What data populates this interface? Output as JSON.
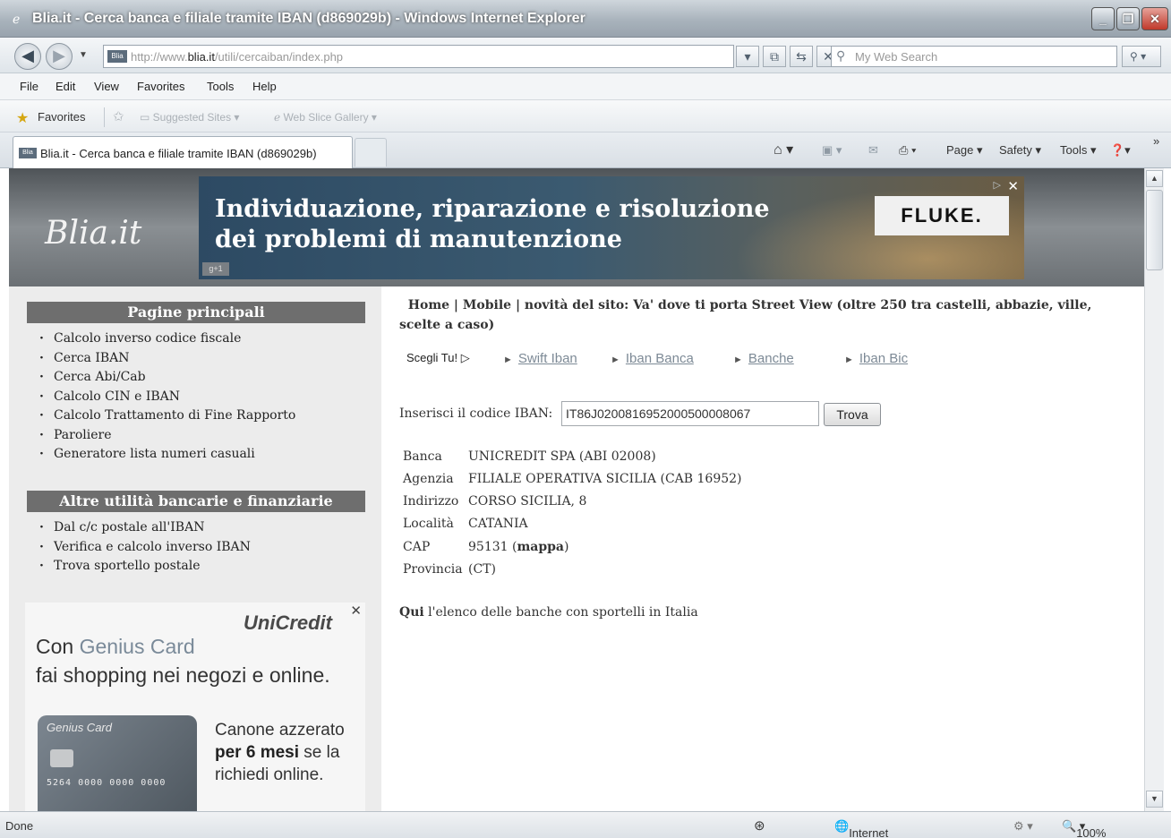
{
  "window": {
    "title": "Blia.it - Cerca banca e filiale tramite IBAN (d869029b) - Windows Internet Explorer",
    "buttons": {
      "minimize": "_",
      "maximize": "❐",
      "close": "✕"
    }
  },
  "address": {
    "url_prefix": "http://www.",
    "url_domain": "blia.it",
    "url_path": "/utili/cercaiban/index.php",
    "search_placeholder": "My Web Search"
  },
  "menu": [
    "File",
    "Edit",
    "View",
    "Favorites",
    "Tools",
    "Help"
  ],
  "favorites_bar": {
    "label": "Favorites",
    "suggested": "Suggested Sites ▾",
    "slice": "Web Slice Gallery ▾"
  },
  "tab": {
    "title": "Blia.it - Cerca banca e filiale tramite IBAN (d869029b)",
    "favicon": "Blia"
  },
  "commandbar": {
    "page": "Page ▾",
    "safety": "Safety ▾",
    "tools": "Tools ▾",
    "overflow": "»"
  },
  "site": {
    "logo": "Blia.it",
    "banner": {
      "headline_1": "Individuazione, riparazione e risoluzione",
      "headline_2": "dei problemi di manutenzione",
      "brand": "FLUKE.",
      "gplus": "g+1"
    }
  },
  "sidebar": {
    "heading_main": "Pagine principali",
    "main_links": [
      "Calcolo inverso codice fiscale",
      "Cerca IBAN",
      "Cerca Abi/Cab",
      "Calcolo CIN e IBAN",
      "Calcolo Trattamento di Fine Rapporto",
      "Paroliere",
      "Generatore lista numeri casuali"
    ],
    "heading_other": "Altre utilità bancarie e finanziarie",
    "other_links": [
      "Dal c/c postale all'IBAN",
      "Verifica e calcolo inverso IBAN",
      "Trova sportello postale"
    ],
    "ad": {
      "logo": "UniCredit",
      "line1_pre": "Con ",
      "line1_highlight": "Genius Card",
      "line2": "fai shopping nei negozi e online.",
      "card_name": "Genius Card",
      "card_number": "5264 0000 0000 0000",
      "promo_1": "Canone azzerato",
      "promo_2_bold": "per 6 mesi",
      "promo_2": " se la",
      "promo_3": "richiedi online."
    }
  },
  "main": {
    "topnav_home": "Home",
    "topnav_mobile": "Mobile",
    "topnav_rest": "| novità del sito: Va' dove ti porta Street View (oltre 250 tra castelli, abbazie, ville, scelte a caso)",
    "scegli": "Scegli Tu! ▷",
    "links": [
      "Swift Iban",
      "Iban Banca",
      "Banche",
      "Iban Bic"
    ],
    "iban_label": "Inserisci il codice IBAN:",
    "iban_value": "IT86J0200816952000500008067",
    "button": "Trova",
    "result": {
      "banca_k": "Banca",
      "banca_v": "UNICREDIT SPA  (ABI 02008)",
      "agenzia_k": "Agenzia",
      "agenzia_v": "FILIALE OPERATIVA SICILIA  (CAB 16952)",
      "indirizzo_k": "Indirizzo",
      "indirizzo_v": "CORSO SICILIA, 8",
      "localita_k": "Località",
      "localita_v": "CATANIA",
      "cap_k": "CAP",
      "cap_v": "95131",
      "cap_link": "mappa",
      "provincia_k": "Provincia",
      "provincia_v": "(CT)"
    },
    "qui_bold": "Qui",
    "qui_rest": " l'elenco delle banche con sportelli in Italia"
  },
  "status": {
    "left": "Done",
    "zone": "Internet",
    "zoom": "100%"
  }
}
